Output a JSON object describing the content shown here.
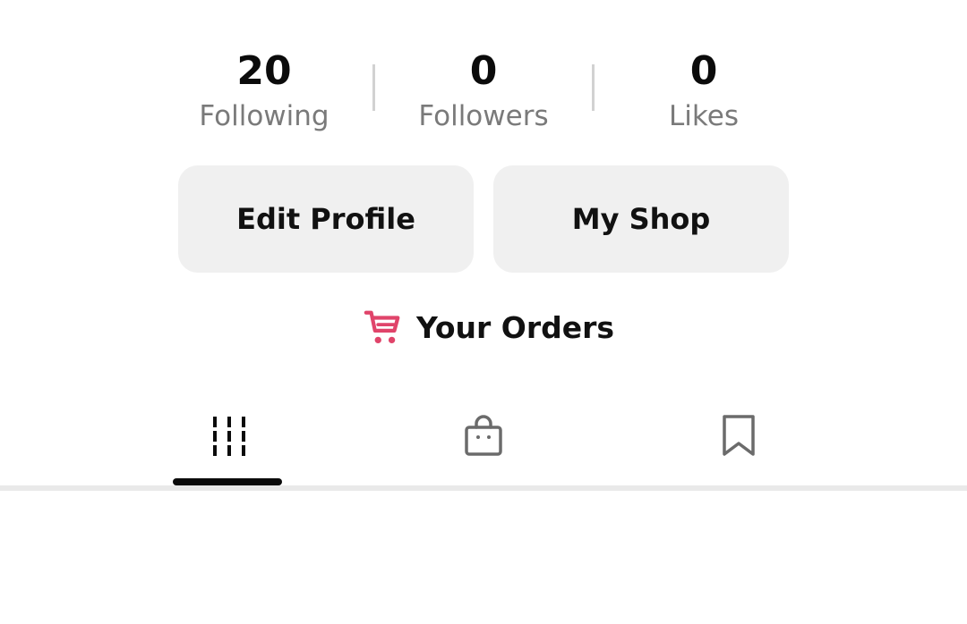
{
  "stats": [
    {
      "value": "20",
      "label": "Following"
    },
    {
      "value": "0",
      "label": "Followers"
    },
    {
      "value": "0",
      "label": "Likes"
    }
  ],
  "buttons": {
    "edit_profile": "Edit Profile",
    "my_shop": "My Shop"
  },
  "orders": {
    "label": "Your Orders",
    "icon": "cart-icon",
    "icon_color": "#e0446a"
  },
  "tabs": [
    {
      "icon": "grid-icon",
      "active": true
    },
    {
      "icon": "shopping-bag-icon",
      "active": false
    },
    {
      "icon": "bookmark-icon",
      "active": false
    }
  ]
}
